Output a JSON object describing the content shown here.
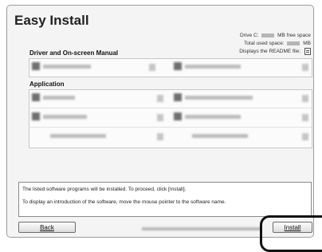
{
  "window": {
    "title": "Easy Install"
  },
  "disk_info": {
    "drive_prefix": "Drive C:",
    "drive_suffix": "MB free space",
    "used_prefix": "Total used space:",
    "used_suffix": "MB",
    "readme_text": "Displays the README file:"
  },
  "sections": {
    "driver_manual": "Driver and On-screen Manual",
    "application": "Application"
  },
  "message": {
    "line1": "The listed software programs will be installed. To proceed, click [Install].",
    "line2": "To display an introduction of the software, move the mouse pointer to the software name."
  },
  "buttons": {
    "back": "Back",
    "install": "Install"
  },
  "colors": {
    "highlight": "#111111",
    "window_bg": "#f4f4f4"
  }
}
